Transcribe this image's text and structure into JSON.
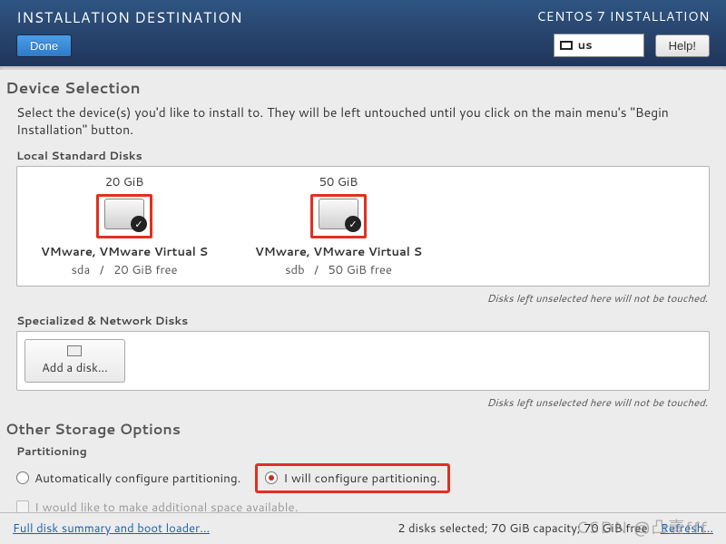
{
  "header": {
    "title": "INSTALLATION DESTINATION",
    "subtitle": "CENTOS 7 INSTALLATION",
    "done_label": "Done",
    "help_label": "Help!",
    "keyboard_layout": "us"
  },
  "device_selection": {
    "heading": "Device Selection",
    "intro": "Select the device(s) you'd like to install to.  They will be left untouched until you click on the main menu's \"Begin Installation\" button.",
    "local_label": "Local Standard Disks",
    "unselected_hint": "Disks left unselected here will not be touched.",
    "disks": [
      {
        "capacity": "20 GiB",
        "model": "VMware, VMware Virtual S",
        "device": "sda",
        "free": "20 GiB free",
        "selected": true
      },
      {
        "capacity": "50 GiB",
        "model": "VMware, VMware Virtual S",
        "device": "sdb",
        "free": "50 GiB free",
        "selected": true
      }
    ],
    "specialized_label": "Specialized & Network Disks",
    "add_disk_label": "Add a disk..."
  },
  "storage_options": {
    "heading": "Other Storage Options",
    "partitioning_label": "Partitioning",
    "auto_label": "Automatically configure partitioning.",
    "manual_label": "I will configure partitioning.",
    "selected": "manual",
    "make_space_label": "I would like to make additional space available."
  },
  "footer": {
    "summary_link": "Full disk summary and boot loader...",
    "status": "2 disks selected; 70 GiB capacity; 70 GiB free",
    "refresh_link": "Refresh..."
  },
  "watermark": "CSDN @凸壹fff"
}
